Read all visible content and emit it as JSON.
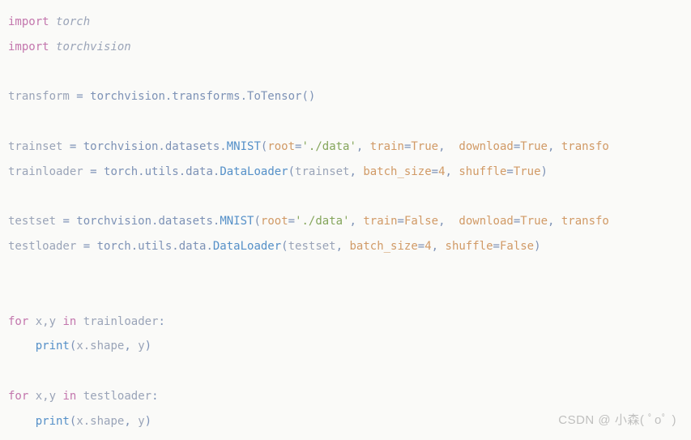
{
  "code": {
    "l1_import": "import",
    "l1_mod": "torch",
    "l2_import": "import",
    "l2_mod": "torchvision",
    "l4_lhs": "transform ",
    "l4_eq": "= ",
    "l4_chain": "torchvision.transforms.ToTensor",
    "l4_par": "()",
    "l6_lhs": "trainset ",
    "l6_eq": "= ",
    "l6_chain": "torchvision.datasets.",
    "l6_call": "MNIST",
    "l6_p1": "(",
    "l6_arg_root": "root",
    "l6_eq2": "=",
    "l6_str": "'./data'",
    "l6_c1": ", ",
    "l6_arg_train": "train",
    "l6_eq3": "=",
    "l6_true": "True",
    "l6_c2": ",  ",
    "l6_arg_dl": "download",
    "l6_eq4": "=",
    "l6_true2": "True",
    "l6_c3": ", ",
    "l6_arg_tf": "transfo",
    "l7_lhs": "trainloader ",
    "l7_eq": "= ",
    "l7_chain": "torch.utils.data.",
    "l7_call": "DataLoader",
    "l7_p1": "(",
    "l7_a1": "trainset",
    "l7_c1": ", ",
    "l7_arg_bs": "batch_size",
    "l7_eq2": "=",
    "l7_num": "4",
    "l7_c2": ", ",
    "l7_arg_sh": "shuffle",
    "l7_eq3": "=",
    "l7_true": "True",
    "l7_p2": ")",
    "l9_lhs": "testset ",
    "l9_eq": "= ",
    "l9_chain": "torchvision.datasets.",
    "l9_call": "MNIST",
    "l9_p1": "(",
    "l9_arg_root": "root",
    "l9_eq2": "=",
    "l9_str": "'./data'",
    "l9_c1": ", ",
    "l9_arg_train": "train",
    "l9_eq3": "=",
    "l9_false": "False",
    "l9_c2": ",  ",
    "l9_arg_dl": "download",
    "l9_eq4": "=",
    "l9_true": "True",
    "l9_c3": ", ",
    "l9_arg_tf": "transfo",
    "l10_lhs": "testloader ",
    "l10_eq": "= ",
    "l10_chain": "torch.utils.data.",
    "l10_call": "DataLoader",
    "l10_p1": "(",
    "l10_a1": "testset",
    "l10_c1": ", ",
    "l10_arg_bs": "batch_size",
    "l10_eq2": "=",
    "l10_num": "4",
    "l10_c2": ", ",
    "l10_arg_sh": "shuffle",
    "l10_eq3": "=",
    "l10_false": "False",
    "l10_p2": ")",
    "l13_for": "for",
    "l13_sp1": " ",
    "l13_xy": "x,y",
    "l13_sp2": " ",
    "l13_in": "in",
    "l13_sp3": " ",
    "l13_it": "trainloader",
    "l13_colon": ":",
    "l14_ind": "    ",
    "l14_print": "print",
    "l14_p1": "(",
    "l14_a1": "x.shape",
    "l14_c": ", ",
    "l14_a2": "y",
    "l14_p2": ")",
    "l16_for": "for",
    "l16_sp1": " ",
    "l16_xy": "x,y",
    "l16_sp2": " ",
    "l16_in": "in",
    "l16_sp3": " ",
    "l16_it": "testloader",
    "l16_colon": ":",
    "l17_ind": "    ",
    "l17_print": "print",
    "l17_p1": "(",
    "l17_a1": "x.shape",
    "l17_c": ", ",
    "l17_a2": "y",
    "l17_p2": ")"
  },
  "watermark": "CSDN @ 小森( ﾟoﾟ )"
}
